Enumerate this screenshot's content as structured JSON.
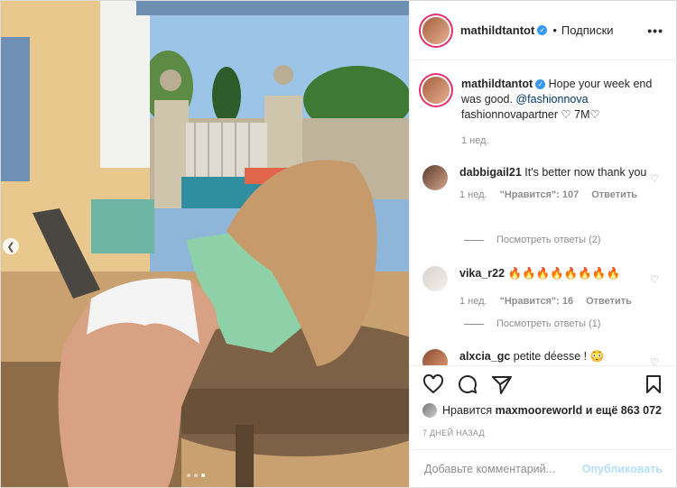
{
  "header": {
    "username": "mathildtantot",
    "separator": "•",
    "follow_label": "Подписки",
    "more_icon": "more-horizontal-icon"
  },
  "caption": {
    "username": "mathildtantot",
    "text_part1": "Hope your week end was good.",
    "mention": "@fashionnova",
    "text_part2": "fashionnovapartner ♡ 7M♡",
    "time": "1 нед."
  },
  "comments": [
    {
      "username": "dabbigail21",
      "text": "It's better now thank you",
      "time": "1 нед.",
      "likes": "\"Нравится\": 107",
      "reply": "Ответить",
      "view_replies": "Посмотреть ответы (2)"
    },
    {
      "username": "vika_r22",
      "text": "🔥🔥🔥🔥🔥🔥🔥🔥",
      "time": "1 нед.",
      "likes": "\"Нравится\": 16",
      "reply": "Ответить",
      "view_replies": "Посмотреть ответы (1)"
    },
    {
      "username": "alxcia_gc",
      "text": "petite déesse ! 😳"
    }
  ],
  "likes": {
    "prefix": "Нравится",
    "user": "maxmooreworld",
    "suffix": "и ещё 863 072"
  },
  "post_date": "7 ДНЕЙ НАЗАД",
  "add_comment": {
    "placeholder": "Добавьте комментарий...",
    "post_label": "Опубликовать"
  },
  "carousel": {
    "total": 3,
    "active": 3
  },
  "colors": {
    "verified": "#3897f0",
    "link": "#00376b",
    "post_disabled": "#b2dffc",
    "ring": "#e1306c"
  }
}
